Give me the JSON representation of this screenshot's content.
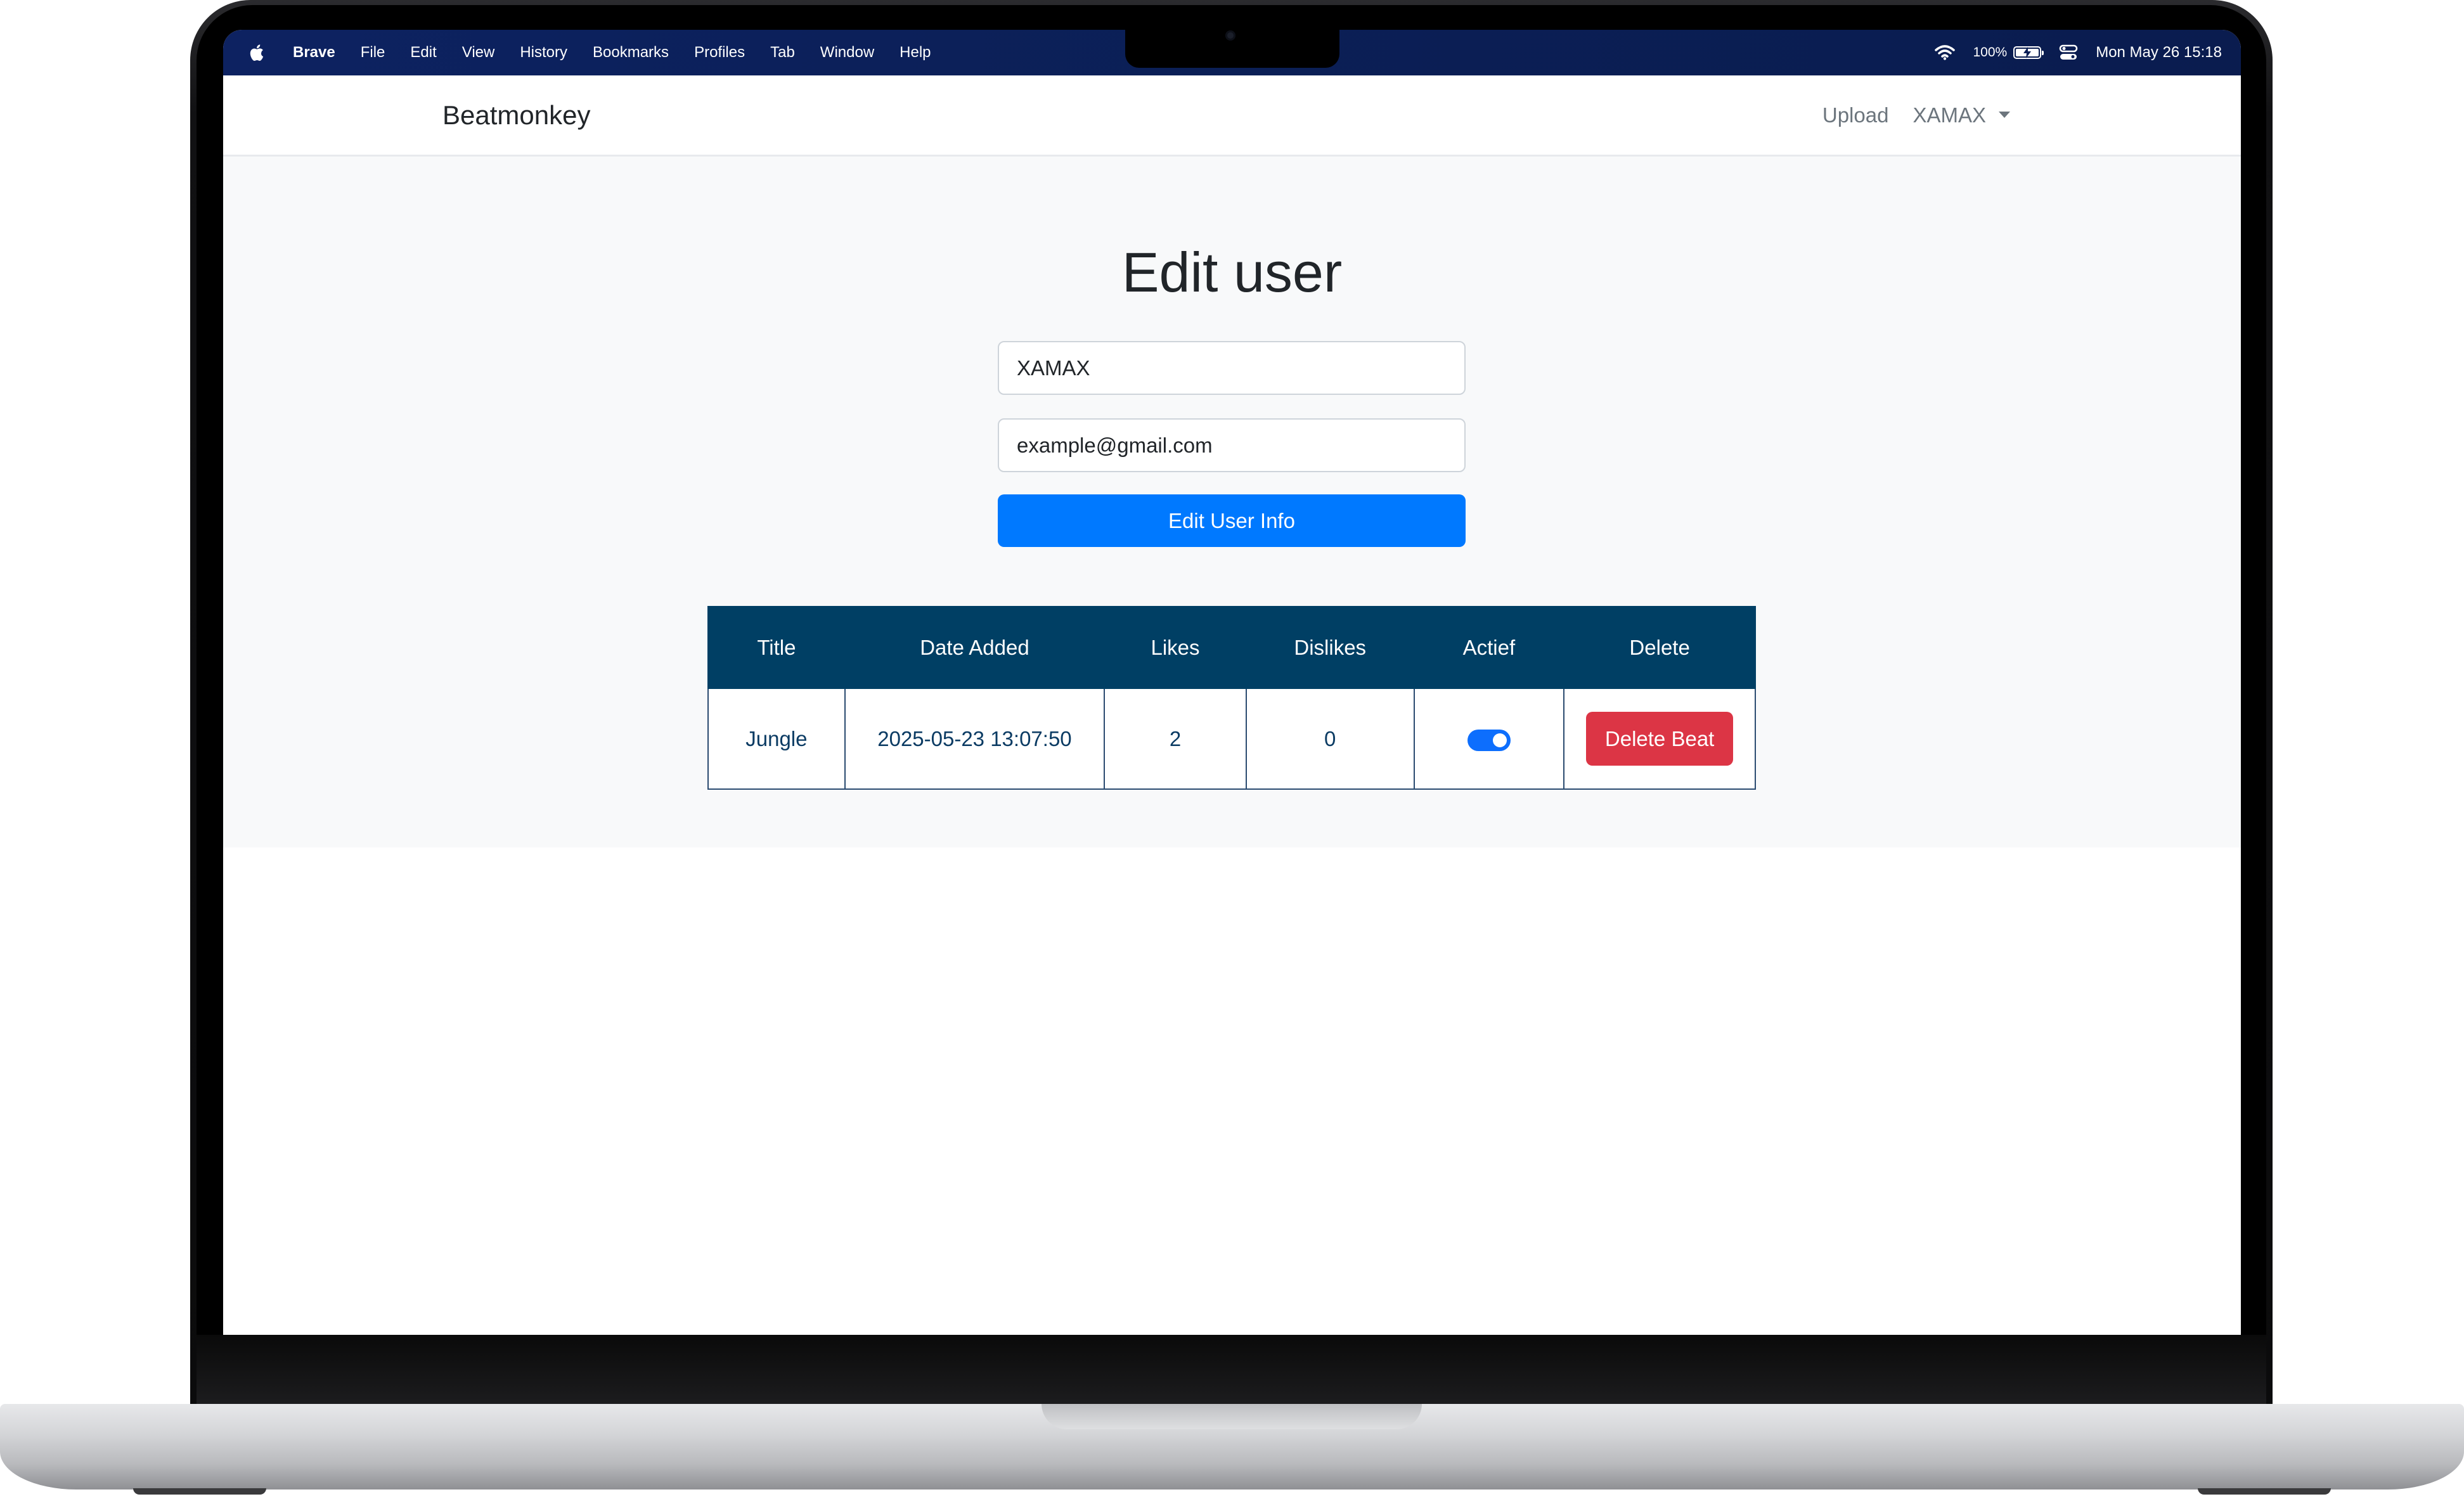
{
  "menubar": {
    "app_name": "Brave",
    "items": [
      "File",
      "Edit",
      "View",
      "History",
      "Bookmarks",
      "Profiles",
      "Tab",
      "Window",
      "Help"
    ],
    "battery_percent": "100%",
    "datetime": "Mon May 26  15:18"
  },
  "navbar": {
    "brand": "Beatmonkey",
    "upload_label": "Upload",
    "user_menu_label": "XAMAX"
  },
  "form": {
    "title": "Edit user",
    "username_value": "XAMAX",
    "email_value": "example@gmail.com",
    "submit_label": "Edit User Info"
  },
  "table": {
    "headers": [
      "Title",
      "Date Added",
      "Likes",
      "Dislikes",
      "Actief",
      "Delete"
    ],
    "rows": [
      {
        "title": "Jungle",
        "date_added": "2025-05-23 13:07:50",
        "likes": "2",
        "dislikes": "0",
        "active": true,
        "delete_label": "Delete Beat"
      }
    ]
  },
  "colors": {
    "menubar_bg": "#0b1f56",
    "primary_button": "#0079ff",
    "table_header": "#003f64",
    "danger_button": "#dc3545",
    "toggle_on": "#0d6efd"
  }
}
